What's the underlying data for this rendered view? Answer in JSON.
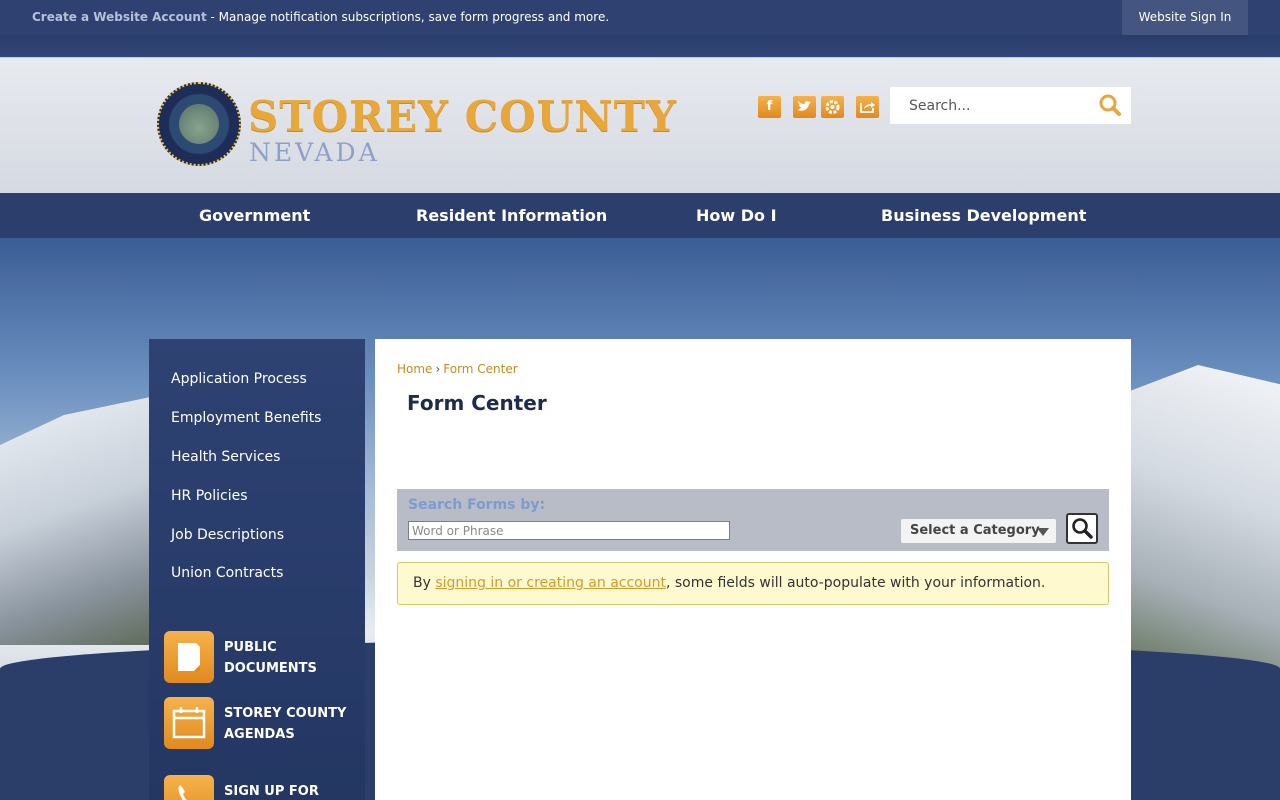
{
  "topbar": {
    "create_account": "Create a Website Account",
    "tagline": " - Manage notification subscriptions, save form progress and more.",
    "sign_in": "Website Sign In"
  },
  "header": {
    "title": "STOREY COUNTY",
    "subtitle": "NEVADA",
    "search_placeholder": "Search...",
    "social_icons": [
      "facebook-icon",
      "twitter-icon",
      "settings-icon",
      "share-icon"
    ]
  },
  "nav": {
    "items": [
      "Government",
      "Resident Information",
      "How Do I",
      "Business Development"
    ]
  },
  "sidebar": {
    "links": [
      "Application Process",
      "Employment Benefits",
      "Health Services",
      "HR Policies",
      "Job Descriptions",
      "Union Contracts"
    ],
    "quick_links": [
      {
        "label": "PUBLIC DOCUMENTS",
        "icon": "document-icon"
      },
      {
        "label": "STOREY COUNTY AGENDAS",
        "icon": "calendar-icon"
      },
      {
        "label": "SIGN UP FOR EMERGENCY",
        "icon": "phone-icon"
      }
    ]
  },
  "main": {
    "breadcrumb": [
      "Home",
      "Form Center"
    ],
    "breadcrumb_sep": "›",
    "title": "Form Center",
    "search_forms": {
      "label": "Search Forms by:",
      "placeholder": "Word or Phrase",
      "category": "Select a Category"
    },
    "notice": {
      "prefix": "By ",
      "link": "signing in or creating an account",
      "suffix": ", some fields will auto-populate with your information."
    }
  },
  "colors": {
    "navy": "#2c3f6c",
    "accent_orange": "#e8a73a",
    "notice_bg": "#fff9cf"
  }
}
